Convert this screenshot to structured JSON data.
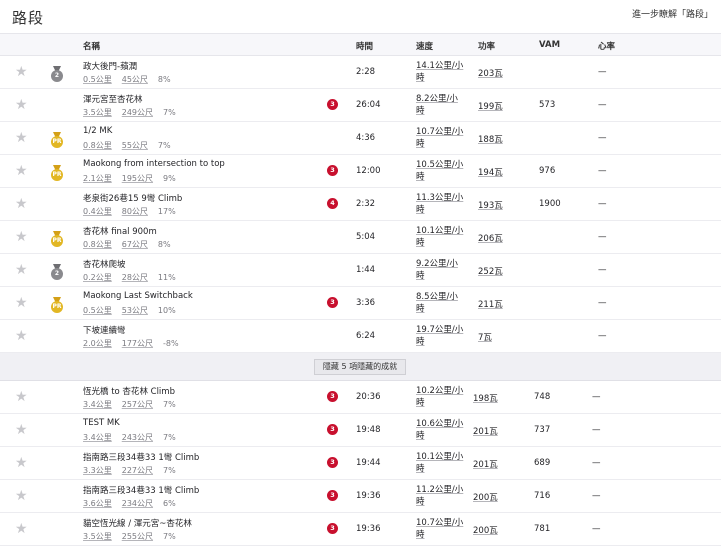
{
  "header": {
    "title": "路段",
    "learn_more": "進一步瞭解「路段」"
  },
  "columns": {
    "name": "名稱",
    "time": "時間",
    "speed": "速度",
    "power": "功率",
    "vam": "VAM",
    "hr": "心率"
  },
  "rows": [
    {
      "medal": "silver",
      "medal_text": "2",
      "name": "政大後門-蘋潤",
      "dist": "0.5公里",
      "elev": "45公尺",
      "grade": "8%",
      "cat": "",
      "time": "2:28",
      "speed_a": "14.1公里/小",
      "speed_b": "時",
      "power": "203瓦",
      "vam": "",
      "hr": "—"
    },
    {
      "medal": "",
      "medal_text": "",
      "name": "渾元宮至杏花林",
      "dist": "3.5公里",
      "elev": "249公尺",
      "grade": "7%",
      "cat": "3",
      "time": "26:04",
      "speed_a": "8.2公里/小",
      "speed_b": "時",
      "power": "199瓦",
      "vam": "573",
      "hr": "—"
    },
    {
      "medal": "gold",
      "medal_text": "PR",
      "name": "1/2 MK",
      "dist": "0.8公里",
      "elev": "55公尺",
      "grade": "7%",
      "cat": "",
      "time": "4:36",
      "speed_a": "10.7公里/小",
      "speed_b": "時",
      "power": "188瓦",
      "vam": "",
      "hr": "—"
    },
    {
      "medal": "gold",
      "medal_text": "PR",
      "name": "Maokong from intersection to top",
      "dist": "2.1公里",
      "elev": "195公尺",
      "grade": "9%",
      "cat": "3",
      "time": "12:00",
      "speed_a": "10.5公里/小",
      "speed_b": "時",
      "power": "194瓦",
      "vam": "976",
      "hr": "—"
    },
    {
      "medal": "",
      "medal_text": "",
      "name": "老泉街26巷15 9彎 Climb",
      "dist": "0.4公里",
      "elev": "80公尺",
      "grade": "17%",
      "cat": "4",
      "time": "2:32",
      "speed_a": "11.3公里/小",
      "speed_b": "時",
      "power": "193瓦",
      "vam": "1900",
      "hr": "—"
    },
    {
      "medal": "gold",
      "medal_text": "PR",
      "name": "杏花林 final 900m",
      "dist": "0.8公里",
      "elev": "67公尺",
      "grade": "8%",
      "cat": "",
      "time": "5:04",
      "speed_a": "10.1公里/小",
      "speed_b": "時",
      "power": "206瓦",
      "vam": "",
      "hr": "—"
    },
    {
      "medal": "silver",
      "medal_text": "2",
      "name": "杏花林爬坡",
      "dist": "0.2公里",
      "elev": "28公尺",
      "grade": "11%",
      "cat": "",
      "time": "1:44",
      "speed_a": "9.2公里/小",
      "speed_b": "時",
      "power": "252瓦",
      "vam": "",
      "hr": "—"
    },
    {
      "medal": "gold",
      "medal_text": "PR",
      "name": "Maokong Last Switchback",
      "dist": "0.5公里",
      "elev": "53公尺",
      "grade": "10%",
      "cat": "3",
      "time": "3:36",
      "speed_a": "8.5公里/小",
      "speed_b": "時",
      "power": "211瓦",
      "vam": "",
      "hr": "—"
    },
    {
      "medal": "",
      "medal_text": "",
      "name": "下坡連續彎",
      "dist": "2.0公里",
      "elev": "177公尺",
      "grade": "-8%",
      "cat": "",
      "time": "6:24",
      "speed_a": "19.7公里/小",
      "speed_b": "時",
      "power": "7瓦",
      "vam": "",
      "hr": "—"
    }
  ],
  "hide_button": "隱藏 5 項隱藏的成就",
  "hidden_rows": [
    {
      "name": "恆光橋 to 杏花林 Climb",
      "dist": "3.4公里",
      "elev": "257公尺",
      "grade": "7%",
      "cat": "3",
      "time": "20:36",
      "speed_a": "10.2公里/小",
      "speed_b": "時",
      "power": "198瓦",
      "vam": "748",
      "hr": "—"
    },
    {
      "name": "TEST MK",
      "dist": "3.4公里",
      "elev": "243公尺",
      "grade": "7%",
      "cat": "3",
      "time": "19:48",
      "speed_a": "10.6公里/小",
      "speed_b": "時",
      "power": "201瓦",
      "vam": "737",
      "hr": "—"
    },
    {
      "name": "指南路三段34巷33 1彎 Climb",
      "dist": "3.3公里",
      "elev": "227公尺",
      "grade": "7%",
      "cat": "3",
      "time": "19:44",
      "speed_a": "10.1公里/小",
      "speed_b": "時",
      "power": "201瓦",
      "vam": "689",
      "hr": "—"
    },
    {
      "name": "指南路三段34巷33 1彎 Climb",
      "dist": "3.6公里",
      "elev": "234公尺",
      "grade": "6%",
      "cat": "3",
      "time": "19:36",
      "speed_a": "11.2公里/小",
      "speed_b": "時",
      "power": "200瓦",
      "vam": "716",
      "hr": "—"
    },
    {
      "name": "貓空恆光線 / 渾元宮~杏花林",
      "dist": "3.5公里",
      "elev": "255公尺",
      "grade": "7%",
      "cat": "3",
      "time": "19:36",
      "speed_a": "10.7公里/小",
      "speed_b": "時",
      "power": "200瓦",
      "vam": "781",
      "hr": "—"
    }
  ]
}
